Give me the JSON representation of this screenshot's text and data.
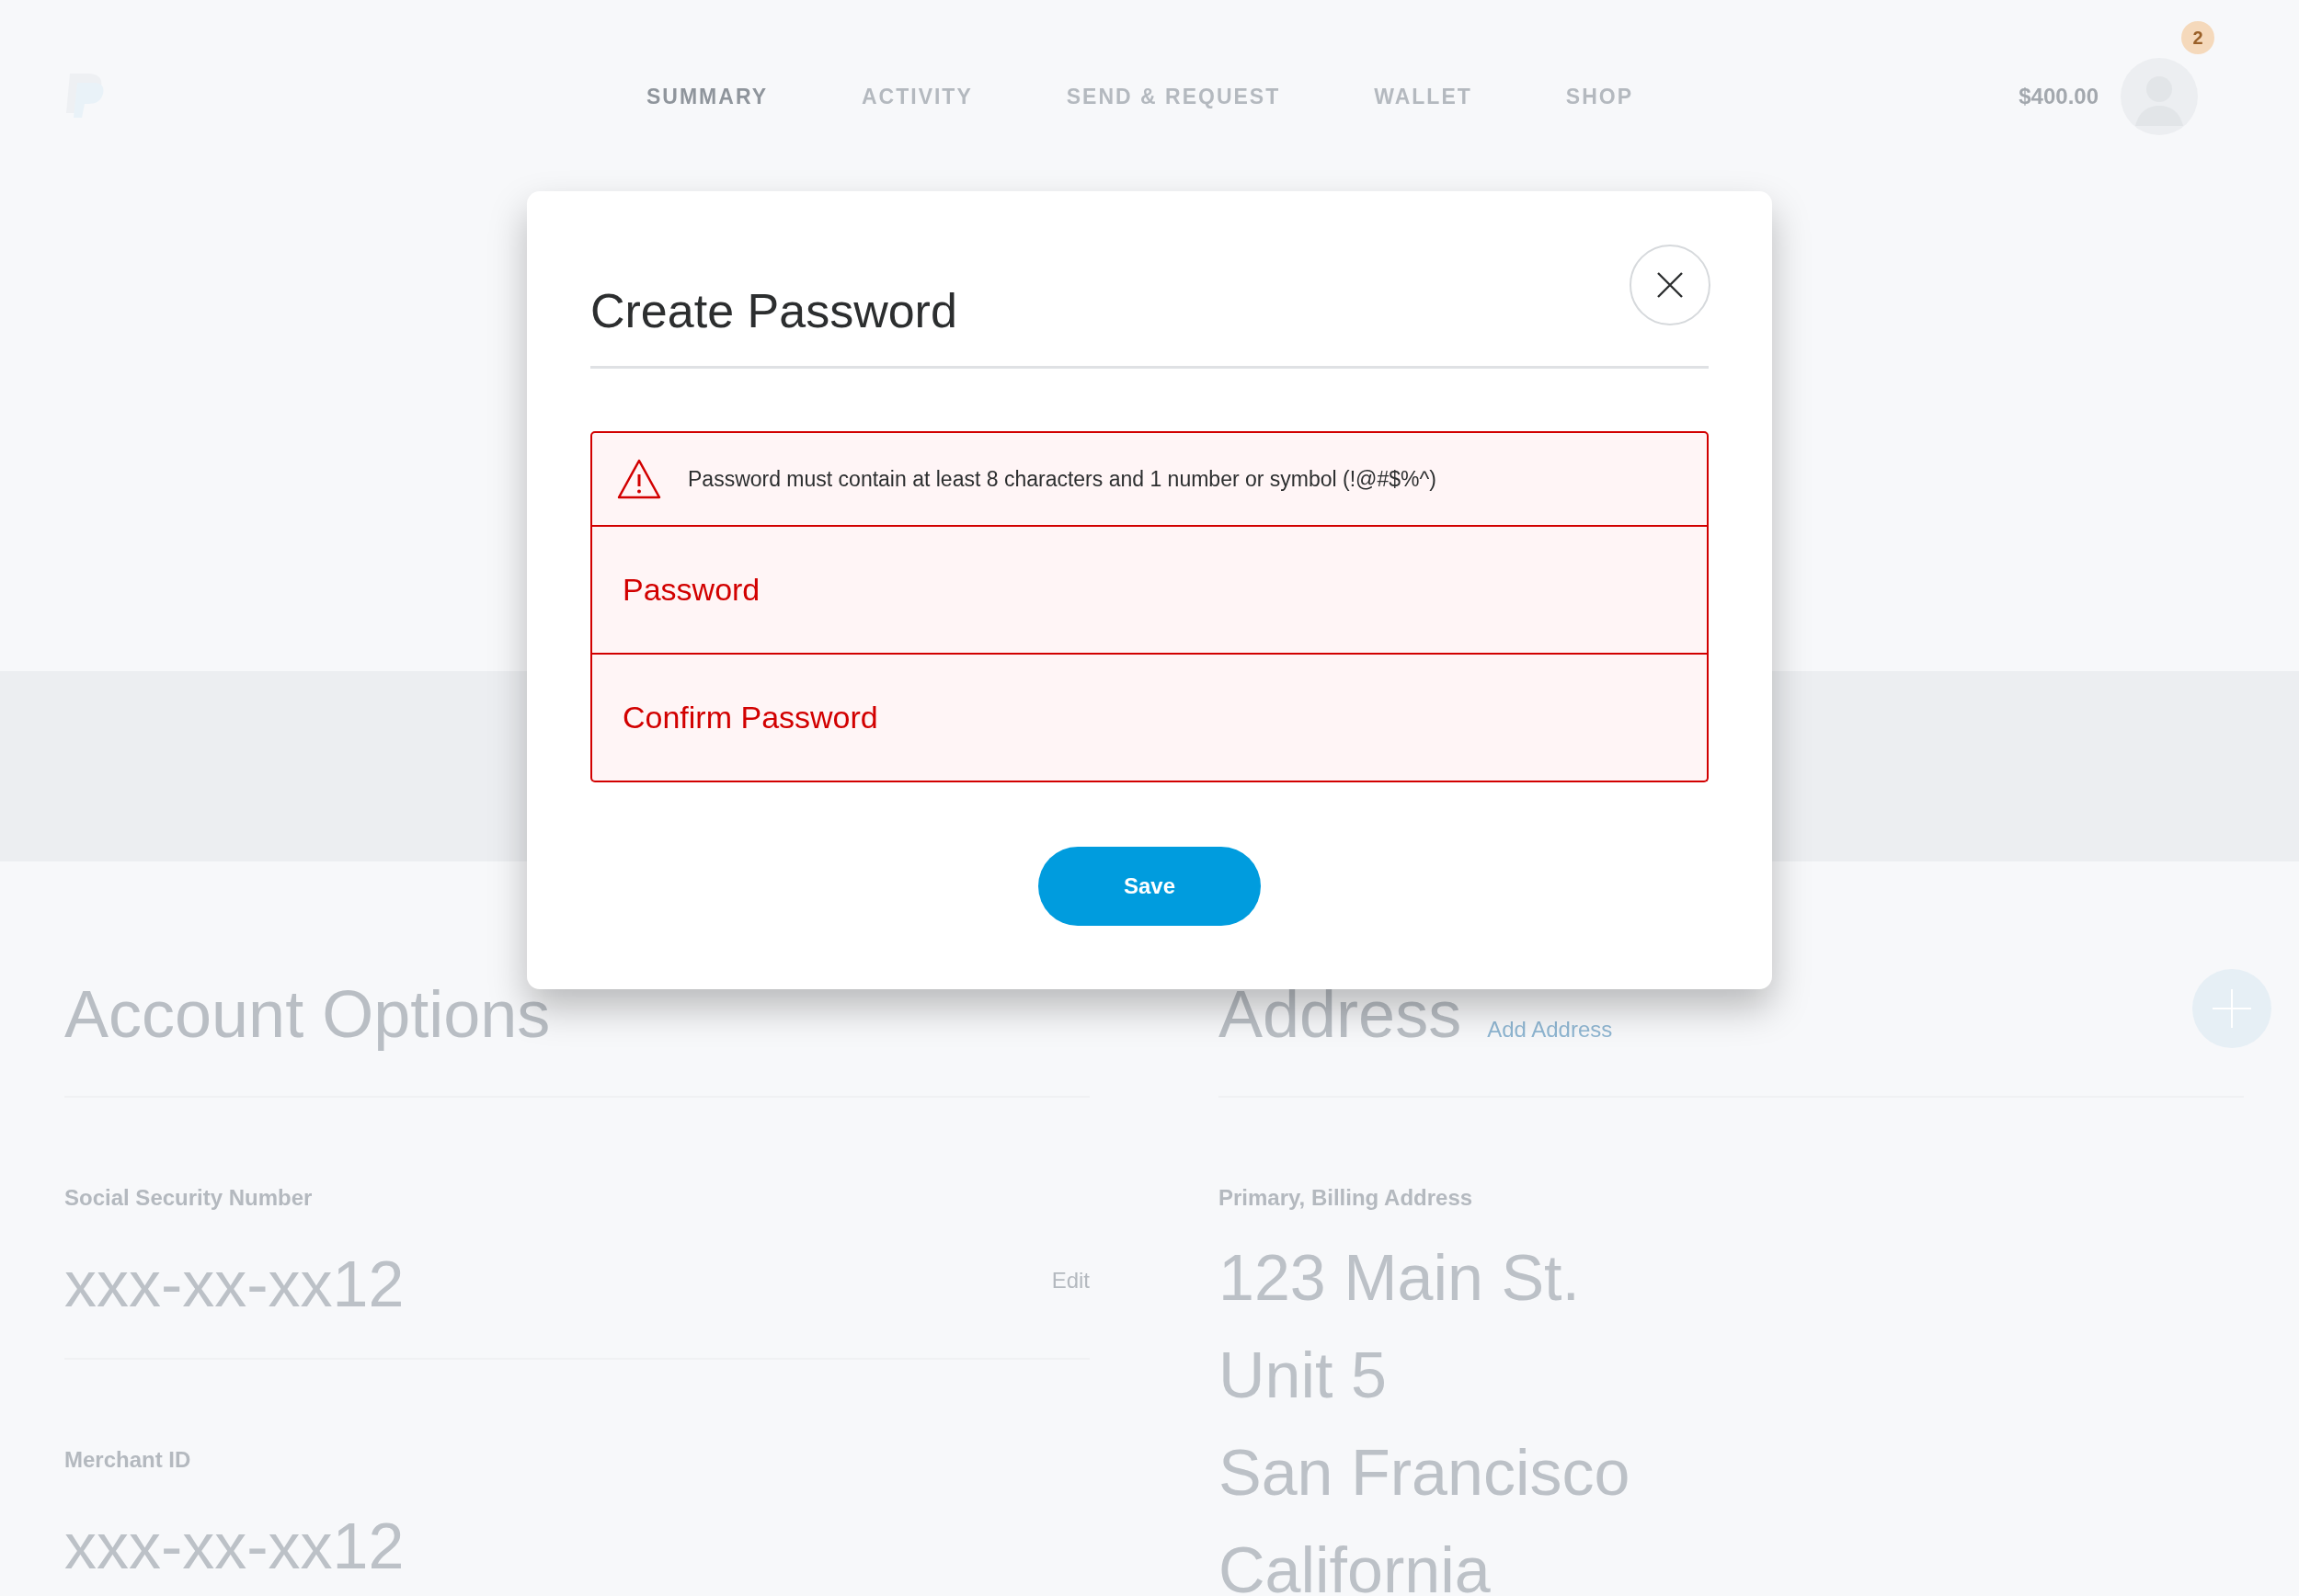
{
  "nav": {
    "items": [
      {
        "label": "SUMMARY",
        "selected": true
      },
      {
        "label": "ACTIVITY",
        "selected": false
      },
      {
        "label": "SEND & REQUEST",
        "selected": false
      },
      {
        "label": "WALLET",
        "selected": false
      },
      {
        "label": "SHOP",
        "selected": false
      }
    ],
    "balance": "$400.00",
    "notification_count": "2"
  },
  "account_options": {
    "title": "Account Options",
    "fields": [
      {
        "label": "Social Security Number",
        "value": "xxx-xx-xx12",
        "action": "Edit"
      },
      {
        "label": "Merchant ID",
        "value": "xxx-xx-xx12"
      }
    ]
  },
  "address": {
    "title": "Address",
    "link": "Add Address",
    "label": "Primary, Billing Address",
    "lines": [
      "123 Main St.",
      "Unit 5",
      "San Francisco",
      "California"
    ]
  },
  "dialog": {
    "title": "Create Password",
    "error": "Password must contain at least 8 characters and 1 number or symbol (!@#$%^)",
    "fields": [
      {
        "placeholder": "Password",
        "invalid": true
      },
      {
        "placeholder": "Confirm Password",
        "invalid": true
      }
    ],
    "button": "Save"
  }
}
